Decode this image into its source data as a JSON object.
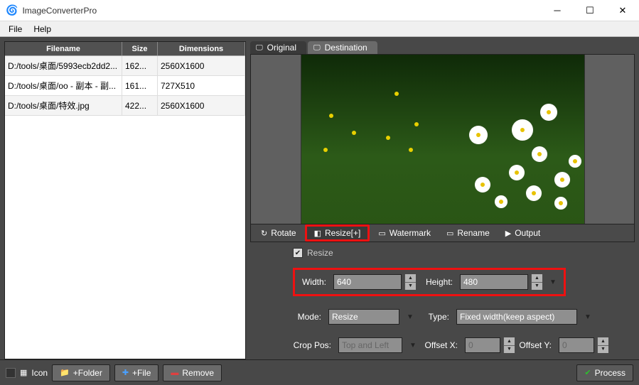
{
  "window": {
    "title": "ImageConverterPro"
  },
  "menu": {
    "file": "File",
    "help": "Help"
  },
  "table": {
    "headers": {
      "filename": "Filename",
      "size": "Size",
      "dimensions": "Dimensions"
    },
    "rows": [
      {
        "filename": "D:/tools/桌面/5993ecb2dd2...",
        "size": "162...",
        "dimensions": "2560X1600"
      },
      {
        "filename": "D:/tools/桌面/oo - 副本 - 副...",
        "size": "161...",
        "dimensions": "727X510"
      },
      {
        "filename": "D:/tools/桌面/特效.jpg",
        "size": "422...",
        "dimensions": "2560X1600"
      }
    ]
  },
  "preview_tabs": {
    "original": "Original",
    "destination": "Destination"
  },
  "toolbar": {
    "rotate": "Rotate",
    "resize": "Resize[+]",
    "watermark": "Watermark",
    "rename": "Rename",
    "output": "Output"
  },
  "settings": {
    "resize_chk": "Resize",
    "width_lbl": "Width:",
    "width_val": "640",
    "height_lbl": "Height:",
    "height_val": "480",
    "mode_lbl": "Mode:",
    "mode_val": "Resize",
    "type_lbl": "Type:",
    "type_val": "Fixed width(keep aspect)",
    "croppos_lbl": "Crop Pos:",
    "croppos_val": "Top and Left",
    "offsetx_lbl": "Offset X:",
    "offsetx_val": "0",
    "offsety_lbl": "Offset Y:",
    "offsety_val": "0"
  },
  "bottom": {
    "icon": "Icon",
    "add_folder": "+Folder",
    "add_file": "+File",
    "remove": "Remove",
    "process": "Process"
  }
}
